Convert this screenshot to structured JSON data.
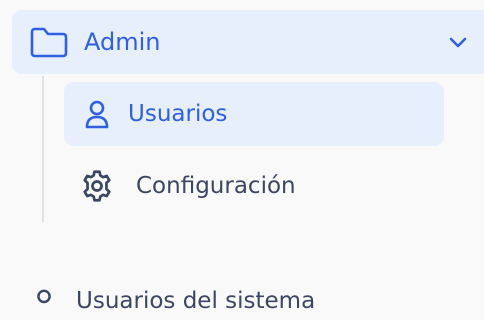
{
  "sidebar": {
    "group": {
      "label": "Admin",
      "icon": "folder-icon",
      "expanded": true,
      "items": [
        {
          "label": "Usuarios",
          "icon": "user-icon",
          "active": true
        },
        {
          "label": "Configuración",
          "icon": "gear-icon",
          "active": false
        }
      ]
    },
    "next_item": {
      "label": "Usuarios del sistema",
      "icon": "user-icon"
    }
  },
  "colors": {
    "accent": "#2f5fe3",
    "active_bg": "#e7eefc",
    "text": "#3b4760",
    "background": "#f9f9fa"
  }
}
